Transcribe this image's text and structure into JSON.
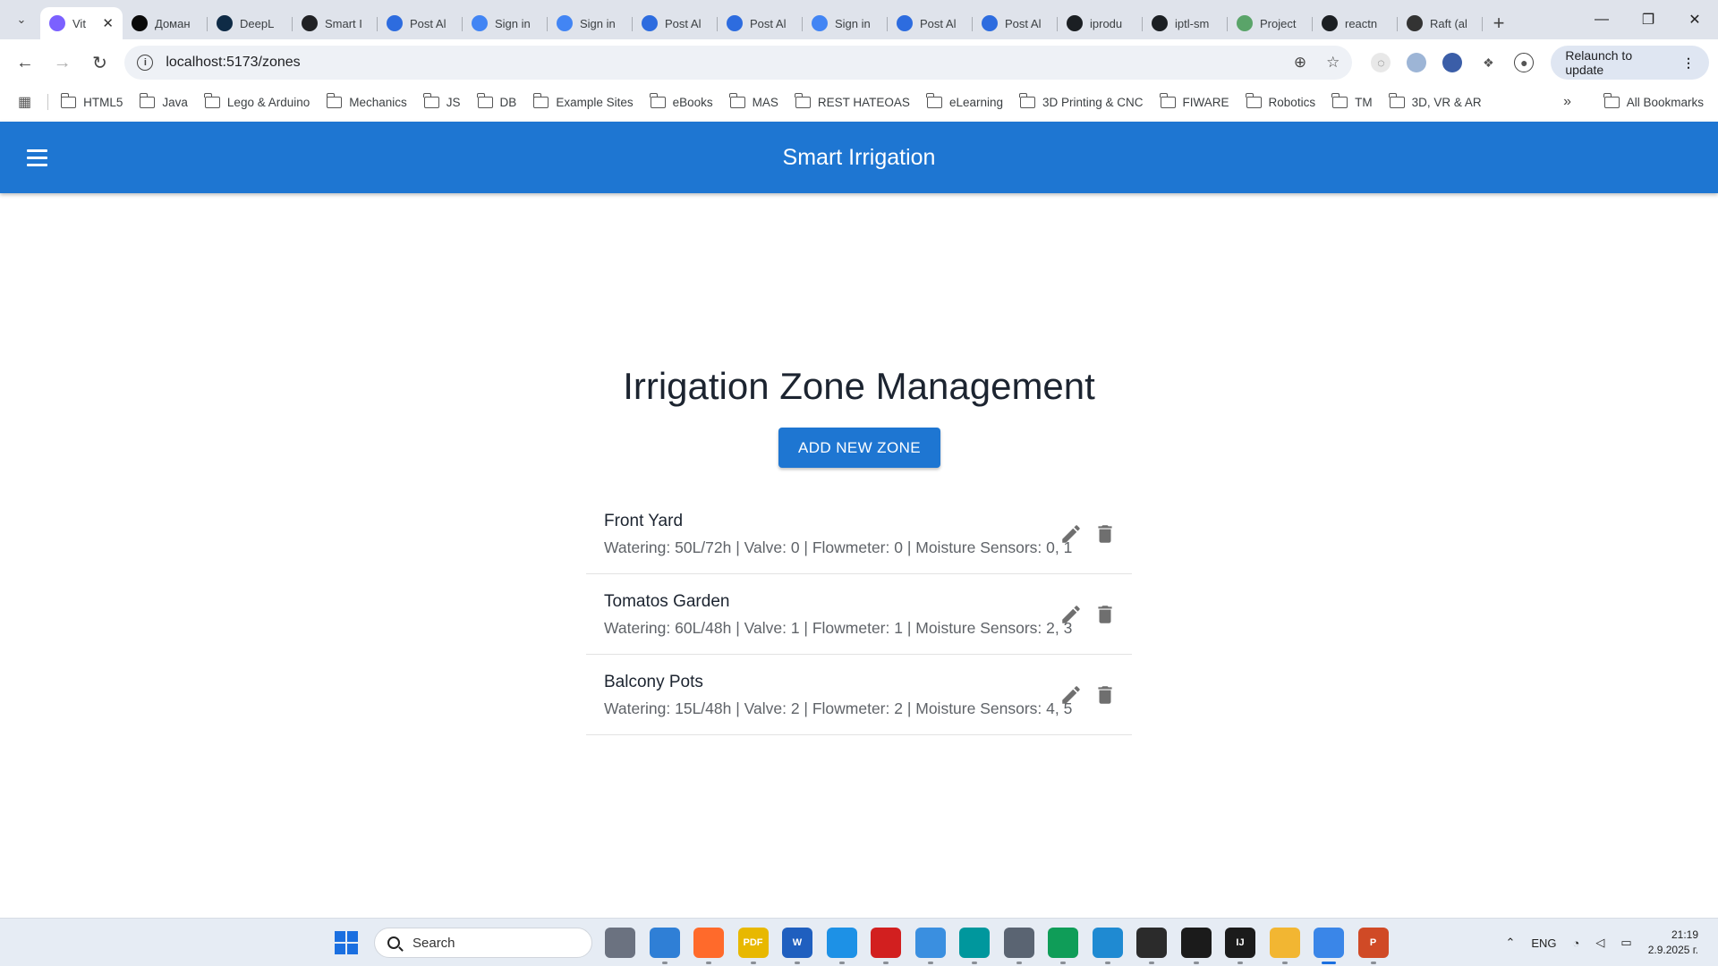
{
  "browser": {
    "tabs": [
      {
        "title": "Vit",
        "active": true,
        "favicon_color": "#7b61ff"
      },
      {
        "title": "Доман",
        "favicon_color": "#0a0a0a"
      },
      {
        "title": "DeepL",
        "favicon_color": "#0f2b46"
      },
      {
        "title": "Smart I",
        "favicon_color": "#202124"
      },
      {
        "title": "Post Al",
        "favicon_color": "#2d6cdf"
      },
      {
        "title": "Sign in",
        "favicon_color": "#4285f4"
      },
      {
        "title": "Sign in",
        "favicon_color": "#4285f4"
      },
      {
        "title": "Post Al",
        "favicon_color": "#2d6cdf"
      },
      {
        "title": "Post Al",
        "favicon_color": "#2d6cdf"
      },
      {
        "title": "Sign in",
        "favicon_color": "#4285f4"
      },
      {
        "title": "Post Al",
        "favicon_color": "#2d6cdf"
      },
      {
        "title": "Post Al",
        "favicon_color": "#2d6cdf"
      },
      {
        "title": "iprodu",
        "favicon_color": "#1b1f23"
      },
      {
        "title": "iptl-sm",
        "favicon_color": "#1b1f23"
      },
      {
        "title": "Project",
        "favicon_color": "#5aa469"
      },
      {
        "title": "reactn",
        "favicon_color": "#1b1f23"
      },
      {
        "title": "Raft (al",
        "favicon_color": "#333333"
      }
    ],
    "new_tab_label": "+",
    "url": "localhost:5173/zones",
    "relaunch_label": "Relaunch to update",
    "bookmarks": [
      "HTML5",
      "Java",
      "Lego & Arduino",
      "Mechanics",
      "JS",
      "DB",
      "Example Sites",
      "eBooks",
      "MAS",
      "REST HATEOAS",
      "eLearning",
      "3D Printing & CNC",
      "FIWARE",
      "Robotics",
      "TM",
      "3D, VR & AR"
    ],
    "more_label": "»",
    "all_bookmarks_label": "All Bookmarks"
  },
  "app": {
    "title": "Smart Irrigation",
    "page_title": "Irrigation Zone Management",
    "add_button_label": "ADD NEW ZONE",
    "accent_color": "#1e76d2",
    "zones": [
      {
        "name": "Front Yard",
        "details": "Watering: 50L/72h | Valve: 0 | Flowmeter: 0 | Moisture Sensors: 0, 1"
      },
      {
        "name": "Tomatos Garden",
        "details": "Watering: 60L/48h | Valve: 1 | Flowmeter: 1 | Moisture Sensors: 2, 3"
      },
      {
        "name": "Balcony Pots",
        "details": "Watering: 15L/48h | Valve: 2 | Flowmeter: 2 | Moisture Sensors: 4, 5"
      }
    ],
    "row_icons": [
      "edit-icon",
      "delete-icon"
    ]
  },
  "taskbar": {
    "search_label": "Search",
    "apps": [
      {
        "name": "task-view-icon",
        "color": "#6b7280"
      },
      {
        "name": "weather-icon",
        "color": "#2f7fd6"
      },
      {
        "name": "firefox-icon",
        "color": "#ff6a2b"
      },
      {
        "name": "pdf-tool-icon",
        "color": "#e8b800",
        "label": "PDF"
      },
      {
        "name": "word-icon",
        "color": "#1f5fbf",
        "label": "W"
      },
      {
        "name": "docker-icon",
        "color": "#1d91e6"
      },
      {
        "name": "acrobat-icon",
        "color": "#d21f1f"
      },
      {
        "name": "paint-icon",
        "color": "#3a8fe0"
      },
      {
        "name": "arduino-icon",
        "color": "#00979d"
      },
      {
        "name": "files-icon",
        "color": "#5a6472"
      },
      {
        "name": "mongodb-icon",
        "color": "#0f9d58"
      },
      {
        "name": "vscode-icon",
        "color": "#1f8ad2"
      },
      {
        "name": "terminal-icon",
        "color": "#2b2b2b"
      },
      {
        "name": "unity-icon",
        "color": "#1b1b1b"
      },
      {
        "name": "intellij-icon",
        "color": "#1b1b1b",
        "label": "IJ"
      },
      {
        "name": "file-explorer-icon",
        "color": "#f2b632"
      },
      {
        "name": "chrome-icon",
        "color": "#3a86e8"
      },
      {
        "name": "powerpoint-icon",
        "color": "#d04a26",
        "label": "P"
      }
    ],
    "language": "ENG",
    "time": "21:19",
    "date": "2.9.2025 г."
  }
}
